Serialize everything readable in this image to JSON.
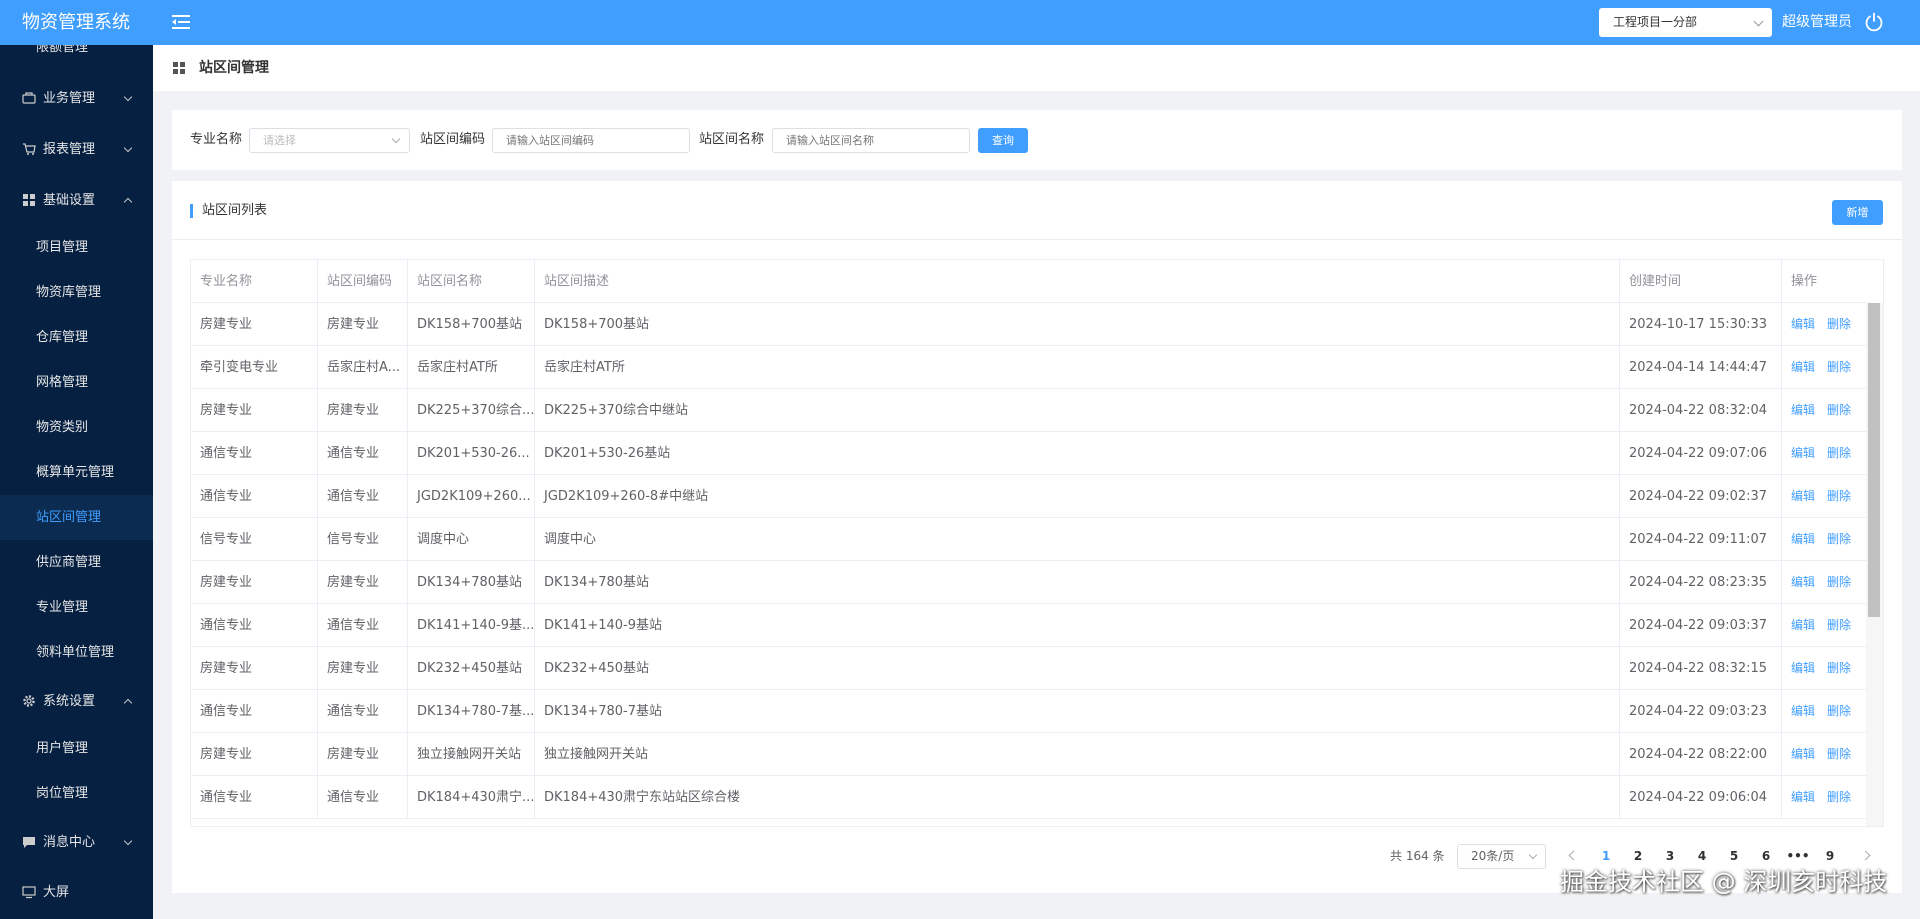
{
  "header": {
    "app_title": "物资管理系统",
    "project_selected": "工程项目一分部",
    "user_name": "超级管理员"
  },
  "sidebar": {
    "items": [
      {
        "label": "限额管理",
        "type": "sub"
      },
      {
        "label": "业务管理",
        "type": "group",
        "icon": "business-icon",
        "arrow": "down"
      },
      {
        "label": "报表管理",
        "type": "group",
        "icon": "report-icon",
        "arrow": "down"
      },
      {
        "label": "基础设置",
        "type": "group",
        "icon": "grid-icon",
        "arrow": "up"
      },
      {
        "label": "项目管理",
        "type": "sub"
      },
      {
        "label": "物资库管理",
        "type": "sub"
      },
      {
        "label": "仓库管理",
        "type": "sub"
      },
      {
        "label": "网格管理",
        "type": "sub"
      },
      {
        "label": "物资类别",
        "type": "sub"
      },
      {
        "label": "概算单元管理",
        "type": "sub"
      },
      {
        "label": "站区间管理",
        "type": "sub",
        "active": true
      },
      {
        "label": "供应商管理",
        "type": "sub"
      },
      {
        "label": "专业管理",
        "type": "sub"
      },
      {
        "label": "领料单位管理",
        "type": "sub"
      },
      {
        "label": "系统设置",
        "type": "group",
        "icon": "gear-icon",
        "arrow": "up"
      },
      {
        "label": "用户管理",
        "type": "sub"
      },
      {
        "label": "岗位管理",
        "type": "sub"
      },
      {
        "label": "消息中心",
        "type": "group",
        "icon": "message-icon",
        "arrow": "down"
      },
      {
        "label": "大屏",
        "type": "group",
        "icon": "monitor-icon"
      }
    ]
  },
  "page": {
    "title": "站区间管理"
  },
  "search": {
    "major_label": "专业名称",
    "major_placeholder": "请选择",
    "code_label": "站区间编码",
    "code_placeholder": "请输入站区间编码",
    "name_label": "站区间名称",
    "name_placeholder": "请输入站区间名称",
    "query_button": "查询"
  },
  "list": {
    "title": "站区间列表",
    "add_button": "新增",
    "columns": [
      "专业名称",
      "站区间编码",
      "站区间名称",
      "站区间描述",
      "创建时间",
      "操作"
    ],
    "edit_label": "编辑",
    "delete_label": "删除",
    "rows": [
      [
        "房建专业",
        "房建专业",
        "DK158+700基站",
        "DK158+700基站",
        "2024-10-17 15:30:33"
      ],
      [
        "牵引变电专业",
        "岳家庄村A...",
        "岳家庄村AT所",
        "岳家庄村AT所",
        "2024-04-14 14:44:47"
      ],
      [
        "房建专业",
        "房建专业",
        "DK225+370综合...",
        "DK225+370综合中继站",
        "2024-04-22 08:32:04"
      ],
      [
        "通信专业",
        "通信专业",
        "DK201+530-26...",
        "DK201+530-26基站",
        "2024-04-22 09:07:06"
      ],
      [
        "通信专业",
        "通信专业",
        "JGD2K109+260...",
        "JGD2K109+260-8#中继站",
        "2024-04-22 09:02:37"
      ],
      [
        "信号专业",
        "信号专业",
        "调度中心",
        "调度中心",
        "2024-04-22 09:11:07"
      ],
      [
        "房建专业",
        "房建专业",
        "DK134+780基站",
        "DK134+780基站",
        "2024-04-22 08:23:35"
      ],
      [
        "通信专业",
        "通信专业",
        "DK141+140-9基...",
        "DK141+140-9基站",
        "2024-04-22 09:03:37"
      ],
      [
        "房建专业",
        "房建专业",
        "DK232+450基站",
        "DK232+450基站",
        "2024-04-22 08:32:15"
      ],
      [
        "通信专业",
        "通信专业",
        "DK134+780-7基...",
        "DK134+780-7基站",
        "2024-04-22 09:03:23"
      ],
      [
        "房建专业",
        "房建专业",
        "独立接触网开关站",
        "独立接触网开关站",
        "2024-04-22 08:22:00"
      ],
      [
        "通信专业",
        "通信专业",
        "DK184+430肃宁...",
        "DK184+430肃宁东站站区综合楼",
        "2024-04-22 09:06:04"
      ]
    ]
  },
  "pagination": {
    "total_text": "共 164 条",
    "page_size": "20条/页",
    "pages": [
      "1",
      "2",
      "3",
      "4",
      "5",
      "6",
      "•••",
      "9"
    ],
    "current": "1"
  },
  "watermark": "掘金技术社区 @ 深圳亥时科技",
  "colors": {
    "primary": "#409eff",
    "sidebar_bg": "#062042",
    "page_bg": "#f0f2f5"
  }
}
